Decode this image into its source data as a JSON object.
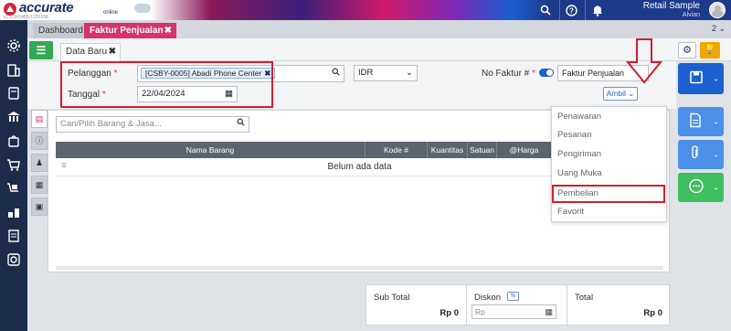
{
  "app": {
    "brand": "accurate",
    "brand_sub": "online",
    "version": "v1.0.1#1485-1220158"
  },
  "topbar": {
    "company": "Retail Sample",
    "user": "Alvian",
    "icons": [
      "search-icon",
      "help-icon",
      "bell-icon"
    ]
  },
  "tabs": {
    "dashboard": "Dashboard",
    "active": "Faktur Penjualan",
    "close": "✖",
    "count": "2"
  },
  "doc": {
    "tab_label": "Data Baru",
    "close": "✖"
  },
  "form": {
    "pelanggan_label": "Pelanggan",
    "pelanggan_value": "[CSBY-0005] Abadi Phone Center",
    "currency": "IDR",
    "faktur_no_label": "No Faktur #",
    "faktur_type": "Faktur Penjualan",
    "tanggal_label": "Tanggal",
    "tanggal_value": "22/04/2024",
    "required_mark": "*"
  },
  "ambil": {
    "label": "Ambil",
    "items": [
      "Penawaran",
      "Pesanan",
      "Pengiriman",
      "Uang Muka",
      "Pembelian",
      "Favorit"
    ],
    "highlighted": "Pembelian"
  },
  "grid": {
    "search_placeholder": "Cari/Pilih Barang & Jasa...",
    "headers": [
      "Nama Barang",
      "Kode #",
      "Kuantitas",
      "Satuan",
      "@Harga"
    ],
    "empty_message": "Belum ada data"
  },
  "totals": {
    "subtotal_label": "Sub Total",
    "subtotal_value": "Rp 0",
    "diskon_label": "Diskon",
    "diskon_tag": "%",
    "diskon_placeholder": "Rp",
    "total_label": "Total",
    "total_value": "Rp 0"
  },
  "colors": {
    "accent": "#d6336c",
    "primary_blue": "#1c5fd0",
    "sidebar": "#1c2b4a",
    "highlight_red": "#d31f2a",
    "green": "#34a853",
    "save_blue": "#1c5fd0",
    "light_blue_btn": "#4b8fe8",
    "green_btn": "#3fbf5f"
  }
}
